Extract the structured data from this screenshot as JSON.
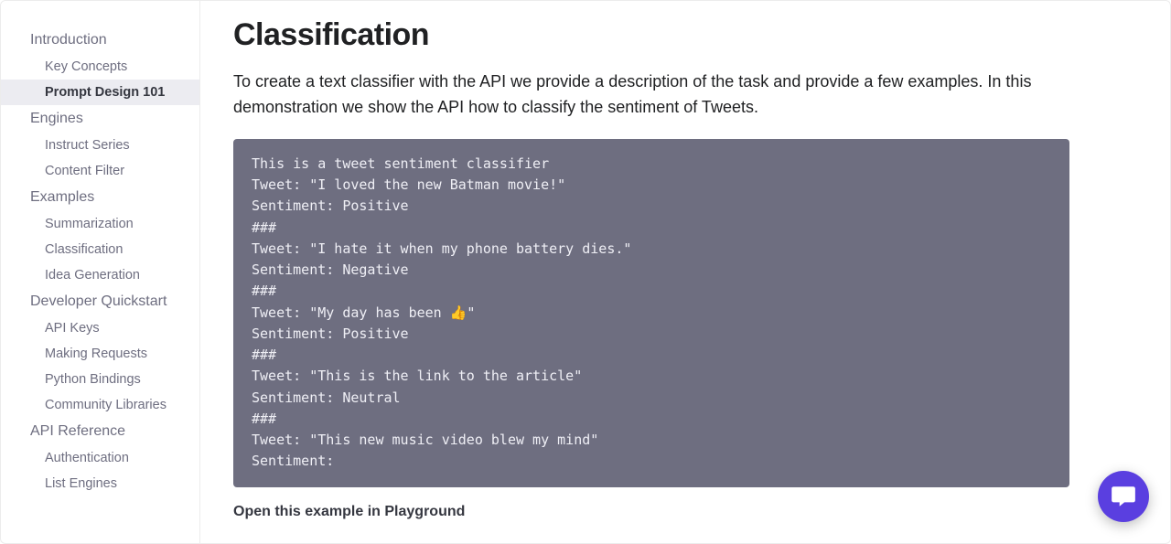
{
  "sidebar": {
    "sections": [
      {
        "title": "Introduction",
        "items": [
          {
            "label": "Key Concepts",
            "active": false
          },
          {
            "label": "Prompt Design 101",
            "active": true
          }
        ]
      },
      {
        "title": "Engines",
        "items": [
          {
            "label": "Instruct Series",
            "active": false
          },
          {
            "label": "Content Filter",
            "active": false
          }
        ]
      },
      {
        "title": "Examples",
        "items": [
          {
            "label": "Summarization",
            "active": false
          },
          {
            "label": "Classification",
            "active": false
          },
          {
            "label": "Idea Generation",
            "active": false
          }
        ]
      },
      {
        "title": "Developer Quickstart",
        "items": [
          {
            "label": "API Keys",
            "active": false
          },
          {
            "label": "Making Requests",
            "active": false
          },
          {
            "label": "Python Bindings",
            "active": false
          },
          {
            "label": "Community Libraries",
            "active": false
          }
        ]
      },
      {
        "title": "API Reference",
        "items": [
          {
            "label": "Authentication",
            "active": false
          },
          {
            "label": "List Engines",
            "active": false
          }
        ]
      }
    ]
  },
  "main": {
    "title": "Classification",
    "intro": "To create a text classifier with the API we provide a description of the task and provide a few examples. In this demonstration we show the API how to classify the sentiment of Tweets.",
    "code": "This is a tweet sentiment classifier\nTweet: \"I loved the new Batman movie!\"\nSentiment: Positive\n###\nTweet: \"I hate it when my phone battery dies.\"\nSentiment: Negative\n###\nTweet: \"My day has been 👍\"\nSentiment: Positive\n###\nTweet: \"This is the link to the article\"\nSentiment: Neutral\n###\nTweet: \"This new music video blew my mind\"\nSentiment:",
    "playground_link": "Open this example in Playground"
  }
}
